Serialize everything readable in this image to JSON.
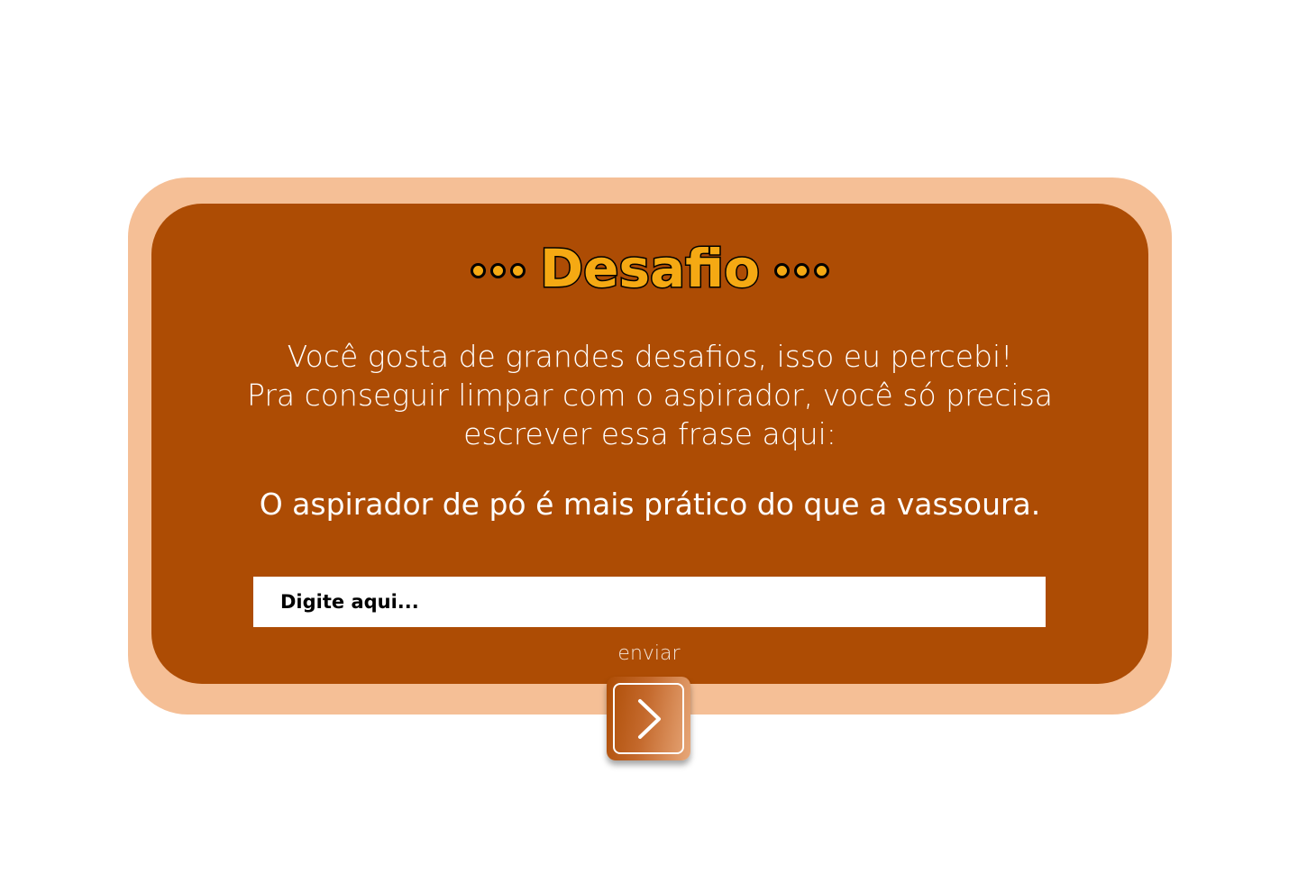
{
  "challenge": {
    "title": "Desafio",
    "intro_lines": [
      "Você gosta de grandes desafios, isso eu percebi!",
      "Pra conseguir limpar com o aspirador, você só precisa",
      "escrever essa frase aqui:"
    ],
    "phrase": "O aspirador de pó é mais prático do que a vassoura.",
    "input": {
      "placeholder": "Digite aqui...",
      "value": ""
    },
    "send_label": "enviar",
    "send_icon": "chevron-right-icon"
  },
  "colors": {
    "page_background": "#ffffff",
    "frame": "#f5bf96",
    "panel": "#ad4c04",
    "title_fill": "#f5a913",
    "title_outline": "#000000",
    "text": "#ffffff"
  }
}
